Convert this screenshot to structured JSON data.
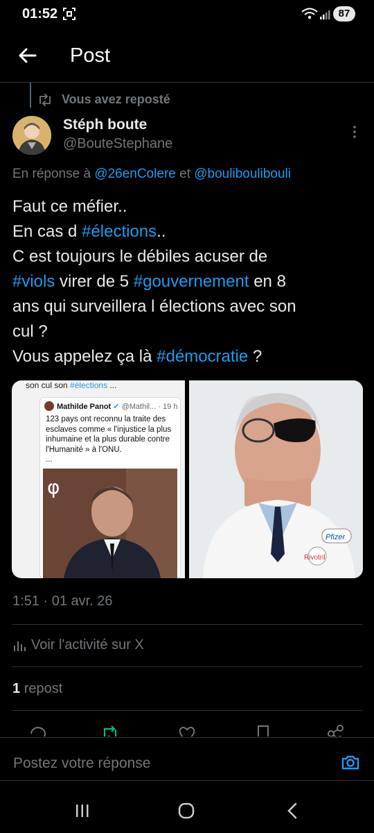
{
  "status_bar": {
    "time": "01:52",
    "battery": "87"
  },
  "header": {
    "title": "Post"
  },
  "repost_context": "Vous avez reposté",
  "author": {
    "name": "Stéph boute",
    "handle": "@BouteStephane"
  },
  "reply_to": {
    "prefix": "En réponse à",
    "user1": "@26enColere",
    "conj": "et",
    "user2": "@bouliboulibouli"
  },
  "body": {
    "l1": "Faut ce méfier..",
    "l2a": "En cas d ",
    "tag1": "#élections",
    "l2b": "..",
    "l3": "C est toujours le débiles acuser de",
    "tag2": "#viols",
    "l4a": " virer de 5 ",
    "tag3": "#gouvernement",
    "l4b": " en 8",
    "l5": "ans qui surveillera l élections avec son",
    "l6": "cul ?",
    "l7a": "Vous appelez ça là ",
    "tag4": "#démocratie",
    "l7b": " ?"
  },
  "media": {
    "img1": {
      "top_text_a": "son cul son ",
      "top_text_tag": "#élections",
      "top_text_b": " ...",
      "quoted_name": "Mathilde Panot",
      "quoted_handle": "@Mathil... · 19 h",
      "quoted_text": "123 pays ont reconnu la traite des esclaves comme « l'injustice la plus inhumaine et la plus durable contre l'Humanité » à l'ONU.",
      "quoted_more": "...",
      "logo": "φ"
    },
    "img2": {
      "badge": "Pfizer",
      "tag": "Rivotril"
    }
  },
  "timestamp": "1:51 · 01 avr. 26",
  "activity": "Voir l'activité sur X",
  "reposts": {
    "count": "1",
    "label": "repost"
  },
  "reply": {
    "placeholder": "Postez votre réponse"
  },
  "icons": {
    "back": "arrow-left-icon",
    "repost": "repost-icon",
    "more": "more-vertical-icon",
    "camera": "camera-icon",
    "activity": "analytics-icon"
  },
  "colors": {
    "accent": "#1d9bf0",
    "muted": "#71767b",
    "repost_green": "#00ba7c"
  }
}
